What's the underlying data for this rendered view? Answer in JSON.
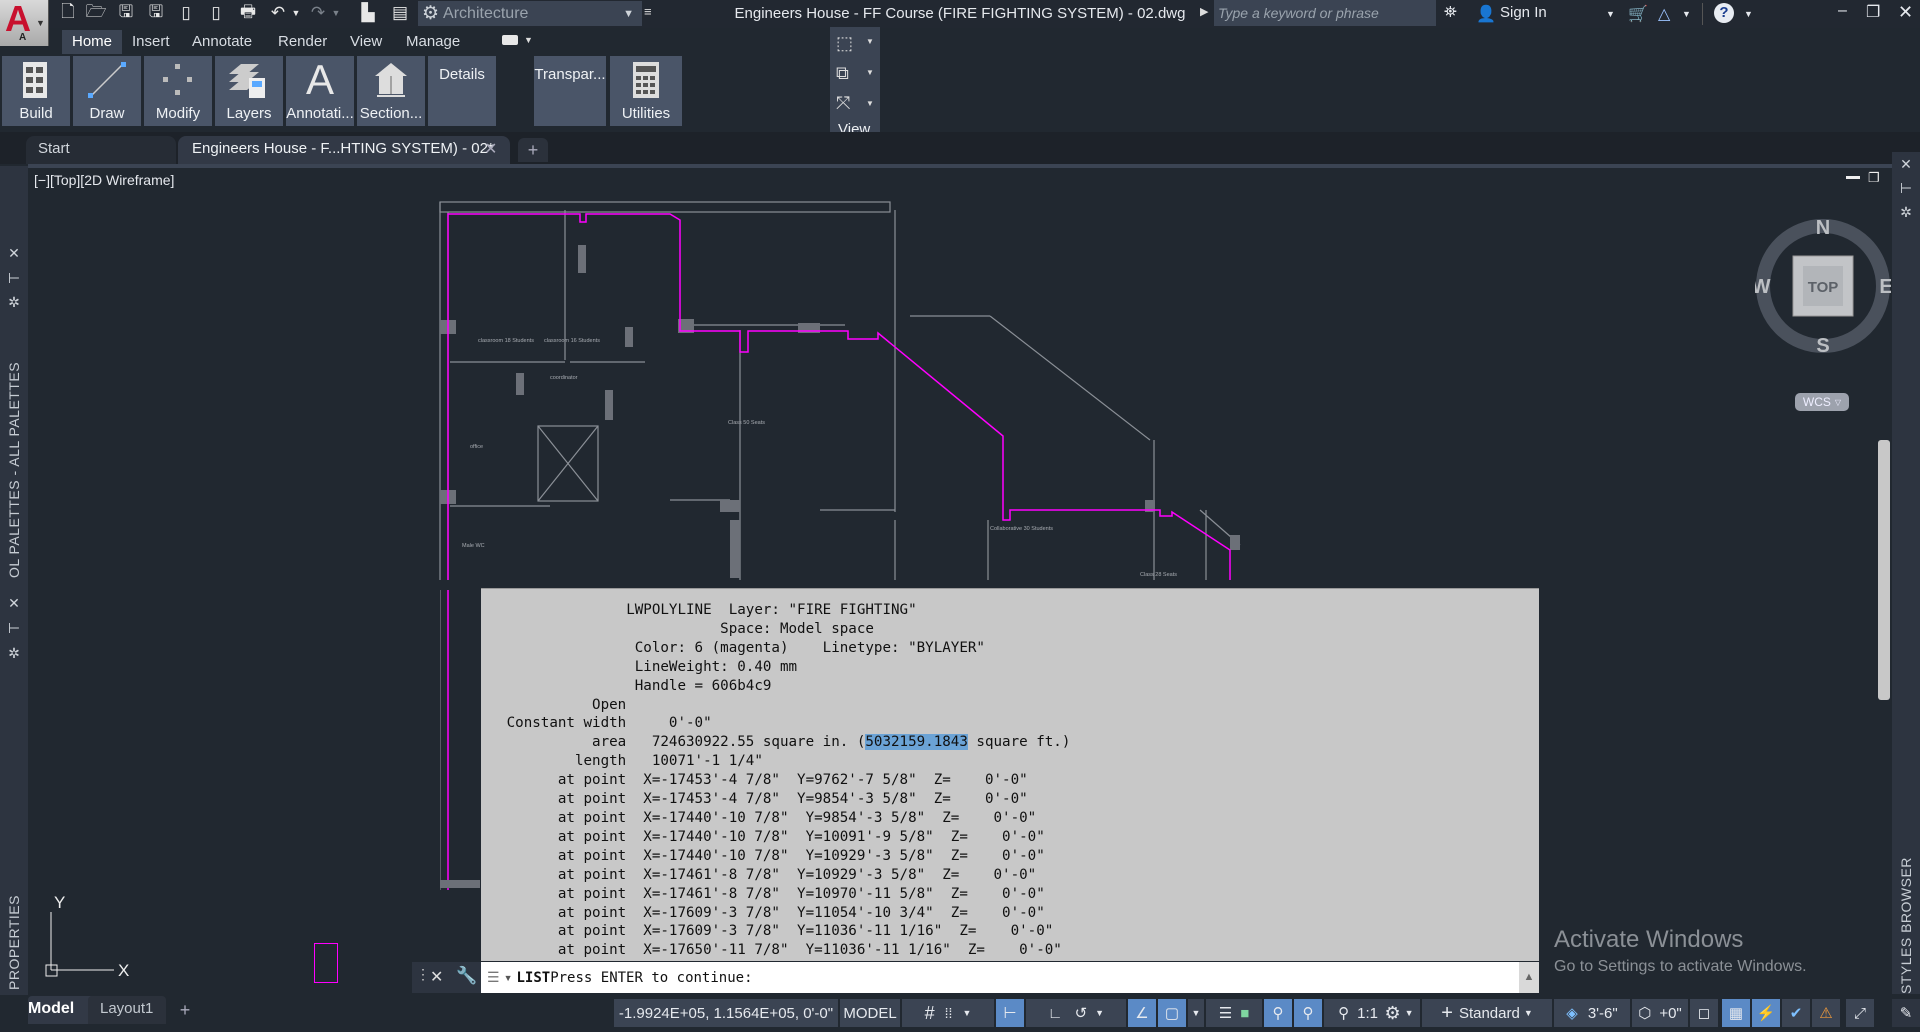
{
  "app": {
    "logo_letter": "A",
    "logo_sub": "A",
    "title": "Engineers House - FF Course (FIRE FIGHTING SYSTEM) - 02.dwg",
    "workspace": "Architecture",
    "search_placeholder": "Type a keyword or phrase",
    "sign_in": "Sign In"
  },
  "quick_access": [
    "new-icon",
    "open-icon",
    "save-icon",
    "save-as-icon",
    "open-from-web-icon",
    "share-icon",
    "plot-icon",
    "undo-icon",
    "redo-icon",
    "batch-publish-icon",
    "sheet-set-icon"
  ],
  "ribbon": {
    "tabs": [
      {
        "label": "Home",
        "active": true
      },
      {
        "label": "Insert"
      },
      {
        "label": "Annotate"
      },
      {
        "label": "Render"
      },
      {
        "label": "View"
      },
      {
        "label": "Manage"
      }
    ],
    "panels": [
      {
        "label": "Build",
        "icon": "build-icon"
      },
      {
        "label": "Draw",
        "icon": "line-icon"
      },
      {
        "label": "Modify",
        "icon": "modify-icon"
      },
      {
        "label": "Layers",
        "icon": "layers-icon"
      },
      {
        "label": "Annotati...",
        "icon": "text-icon"
      },
      {
        "label": "Section...",
        "icon": "section-icon"
      },
      {
        "label": "Details"
      },
      {
        "label": "Transpar..."
      },
      {
        "label": "Utilities",
        "icon": "calculator-icon"
      }
    ],
    "view_panel_label": "View"
  },
  "file_tabs": {
    "start": "Start",
    "active": "Engineers House - F...HTING SYSTEM) - 02*"
  },
  "viewport": {
    "label": "[−][Top][2D Wireframe]",
    "room_labels": [
      "classroom 18 Students",
      "classroom 16 Students",
      "coordinator",
      "office",
      "Male WC",
      "Class 50 Seats",
      "Collaborative 30 Students",
      "Class 28 Seats"
    ]
  },
  "palettes": {
    "tool_palettes": "OL PALETTES - ALL PALETTES",
    "properties": "PROPERTIES",
    "styles_browser": "STYLES BROWSER"
  },
  "viewcube": {
    "top": "TOP",
    "n": "N",
    "s": "S",
    "e": "E",
    "w": "W",
    "ucs": "WCS"
  },
  "ucs_icon": {
    "x": "X",
    "y": "Y"
  },
  "command": {
    "history": [
      "                 LWPOLYLINE  Layer: \"FIRE FIGHTING\"",
      "                            Space: Model space",
      "                  Color: 6 (magenta)    Linetype: \"BYLAYER\"",
      "                  LineWeight: 0.40 mm",
      "                  Handle = 606b4c9",
      "             Open",
      "   Constant width     0'-0\"",
      "             area   724630922.55 square in. (",
      "           length   10071'-1 1/4\"",
      "         at point  X=-17453'-4 7/8\"  Y=9762'-7 5/8\"  Z=    0'-0\"",
      "         at point  X=-17453'-4 7/8\"  Y=9854'-3 5/8\"  Z=    0'-0\"",
      "         at point  X=-17440'-10 7/8\"  Y=9854'-3 5/8\"  Z=    0'-0\"",
      "         at point  X=-17440'-10 7/8\"  Y=10091'-9 5/8\"  Z=    0'-0\"",
      "         at point  X=-17440'-10 7/8\"  Y=10929'-3 5/8\"  Z=    0'-0\"",
      "         at point  X=-17461'-8 7/8\"  Y=10929'-3 5/8\"  Z=    0'-0\"",
      "         at point  X=-17461'-8 7/8\"  Y=10970'-11 5/8\"  Z=    0'-0\"",
      "         at point  X=-17609'-3 7/8\"  Y=11054'-10 3/4\"  Z=    0'-0\"",
      "         at point  X=-17609'-3 7/8\"  Y=11036'-11 1/16\"  Z=    0'-0\"",
      "         at point  X=-17650'-11 7/8\"  Y=11036'-11 1/16\"  Z=    0'-0\""
    ],
    "area_highlight": "5032159.1843",
    "area_suffix": " square ft.)",
    "prompt_keyword": "LIST",
    "prompt_text": " Press ENTER to continue:"
  },
  "layout_tabs": [
    "Model",
    "Layout1"
  ],
  "status": {
    "coordinates": "-1.9924E+05, 1.1564E+05, 0'-0\"",
    "space": "MODEL",
    "annotation_scale": "1:1",
    "style": "Standard",
    "cut_plane": "3'-6\"",
    "elevation_offset": "+0\""
  },
  "watermark": {
    "title": "Activate Windows",
    "subtitle": "Go to Settings to activate Windows."
  },
  "colors": {
    "accent": "#5b8ac6",
    "polyline": "#ff00ff",
    "background": "#212830"
  }
}
